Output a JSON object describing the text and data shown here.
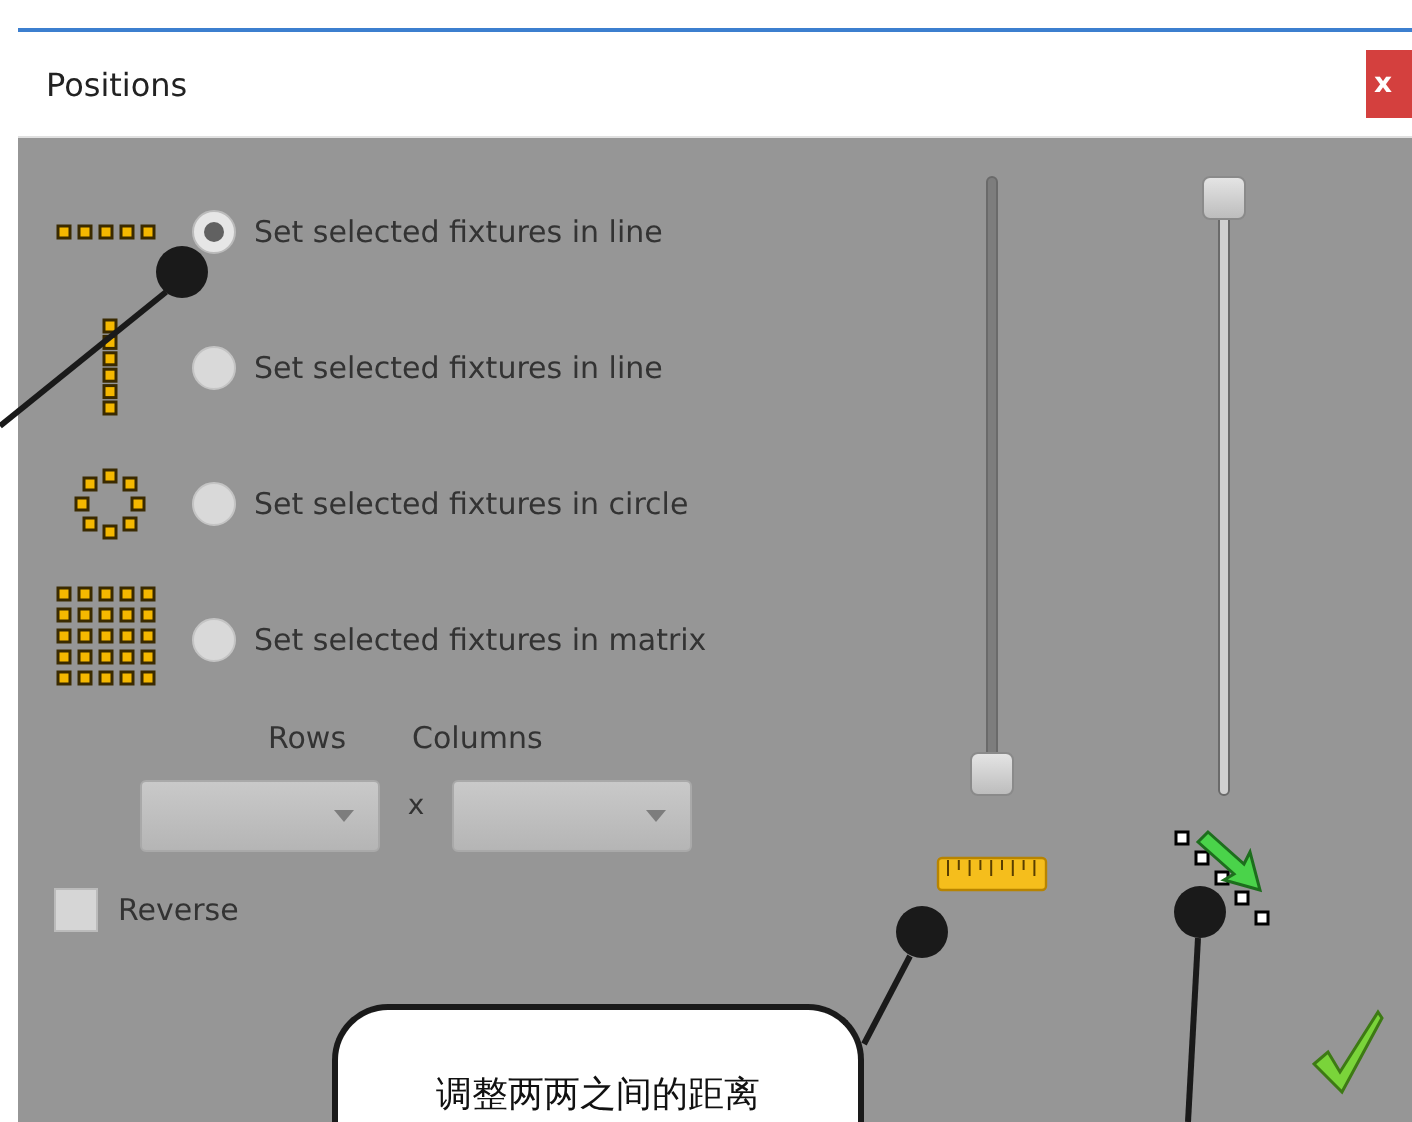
{
  "window": {
    "title": "Positions",
    "close": "x"
  },
  "options": [
    {
      "kind": "row",
      "label": "Set selected fixtures in line",
      "selected": true
    },
    {
      "kind": "column",
      "label": "Set selected fixtures in line",
      "selected": false
    },
    {
      "kind": "circle",
      "label": "Set selected fixtures in circle",
      "selected": false
    },
    {
      "kind": "matrix",
      "label": "Set selected fixtures in matrix",
      "selected": false
    }
  ],
  "matrix": {
    "rows_label": "Rows",
    "separator": "x",
    "columns_label": "Columns"
  },
  "reverse": {
    "label": "Reverse",
    "checked": false
  },
  "sliders": [
    {
      "kind": "spacing",
      "level": 0
    },
    {
      "kind": "spread",
      "level": 1
    }
  ],
  "callout": {
    "text": "调整两两之间的距离"
  }
}
